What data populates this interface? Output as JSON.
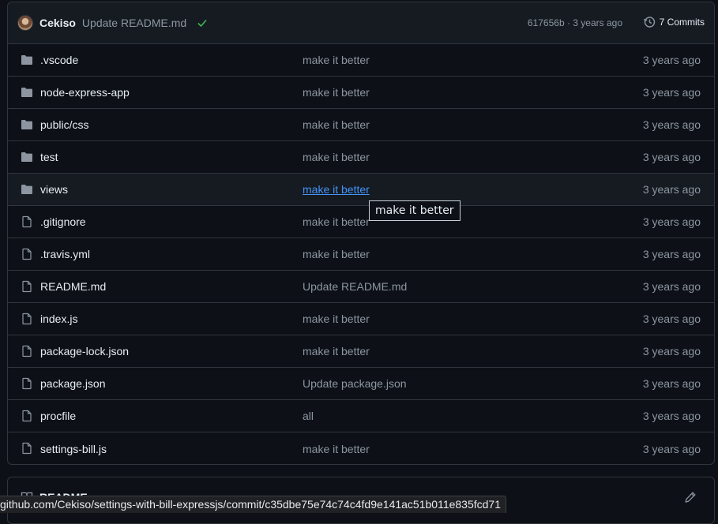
{
  "commit": {
    "author": "Cekiso",
    "message": "Update README.md",
    "hash_age": "617656b · 3 years ago",
    "commits_label": "7 Commits"
  },
  "files": [
    {
      "name": ".vscode",
      "type": "folder",
      "message": "make it better",
      "age": "3 years ago"
    },
    {
      "name": "node-express-app",
      "type": "folder",
      "message": "make it better",
      "age": "3 years ago"
    },
    {
      "name": "public/css",
      "type": "folder",
      "message": "make it better",
      "age": "3 years ago"
    },
    {
      "name": "test",
      "type": "folder",
      "message": "make it better",
      "age": "3 years ago"
    },
    {
      "name": "views",
      "type": "folder",
      "message": "make it better",
      "age": "3 years ago"
    },
    {
      "name": ".gitignore",
      "type": "file",
      "message": "make it better",
      "age": "3 years ago"
    },
    {
      "name": ".travis.yml",
      "type": "file",
      "message": "make it better",
      "age": "3 years ago"
    },
    {
      "name": "README.md",
      "type": "file",
      "message": "Update README.md",
      "age": "3 years ago"
    },
    {
      "name": "index.js",
      "type": "file",
      "message": "make it better",
      "age": "3 years ago"
    },
    {
      "name": "package-lock.json",
      "type": "file",
      "message": "make it better",
      "age": "3 years ago"
    },
    {
      "name": "package.json",
      "type": "file",
      "message": "Update package.json",
      "age": "3 years ago"
    },
    {
      "name": "procfile",
      "type": "file",
      "message": "all",
      "age": "3 years ago"
    },
    {
      "name": "settings-bill.js",
      "type": "file",
      "message": "make it better",
      "age": "3 years ago"
    }
  ],
  "tooltip": "make it better",
  "readme": {
    "title": "README"
  },
  "status_url": "github.com/Cekiso/settings-with-bill-expressjs/commit/c35dbe75e74c74c4fd9e141ac51b011e835fcd71",
  "colors": {
    "accent_link": "#4493f8",
    "success": "#3fb950",
    "muted": "#8d96a0",
    "background": "#0d1117"
  }
}
